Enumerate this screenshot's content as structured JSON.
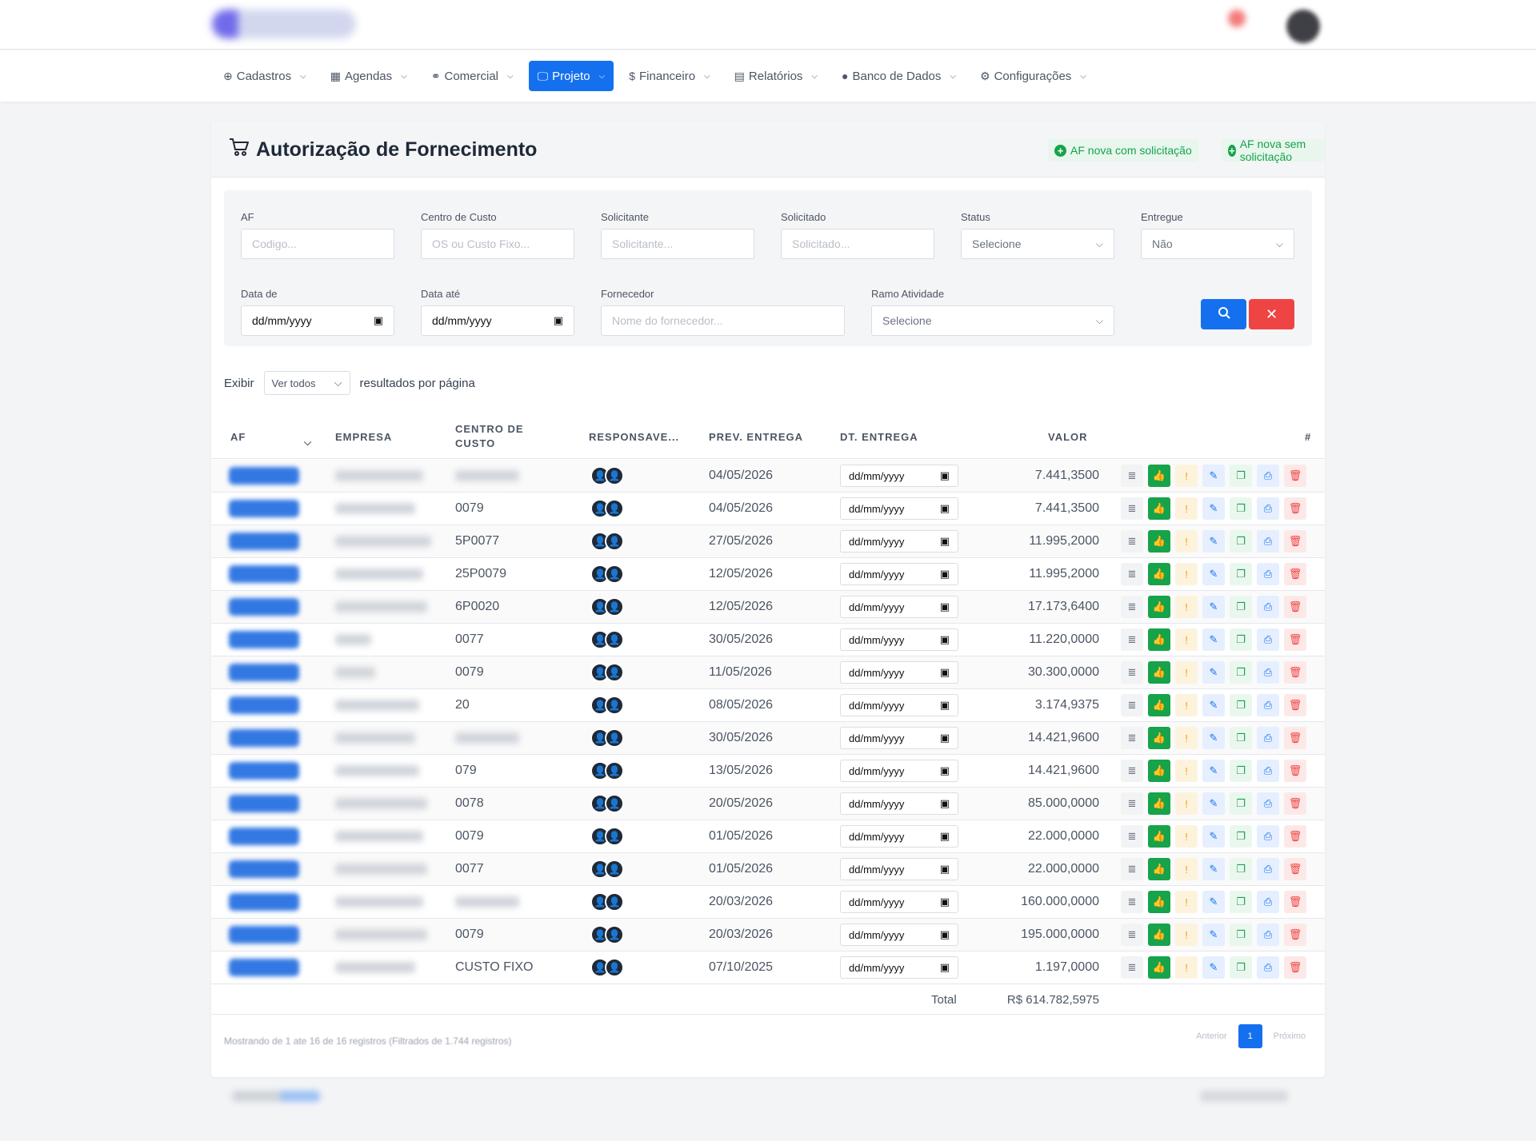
{
  "nav": [
    {
      "label": "Cadastros",
      "icon": "plus-circle-icon",
      "glyph": "⊕"
    },
    {
      "label": "Agendas",
      "icon": "calendar-icon",
      "glyph": "▦"
    },
    {
      "label": "Comercial",
      "icon": "handshake-icon",
      "glyph": "⚭"
    },
    {
      "label": "Projeto",
      "icon": "monitor-icon",
      "glyph": "🖵",
      "active": true
    },
    {
      "label": "Financeiro",
      "icon": "dollar-circle-icon",
      "glyph": "$"
    },
    {
      "label": "Relatórios",
      "icon": "report-icon",
      "glyph": "▤"
    },
    {
      "label": "Banco de Dados",
      "icon": "database-icon",
      "glyph": "●"
    },
    {
      "label": "Configurações",
      "icon": "gear-icon",
      "glyph": "⚙"
    }
  ],
  "page": {
    "title": "Autorização de Fornecimento",
    "badge_with": "AF nova com solicitação",
    "badge_without": "AF nova sem solicitação"
  },
  "filters": {
    "af": {
      "label": "AF",
      "placeholder": "Codigo..."
    },
    "cc": {
      "label": "Centro de Custo",
      "placeholder": "OS ou Custo Fixo..."
    },
    "solicitante": {
      "label": "Solicitante",
      "placeholder": "Solicitante..."
    },
    "solicitado": {
      "label": "Solicitado",
      "placeholder": "Solicitado..."
    },
    "status": {
      "label": "Status",
      "value": "Selecione"
    },
    "entregue": {
      "label": "Entregue",
      "value": "Não"
    },
    "data_de": {
      "label": "Data de",
      "value": "dd/mm/yyyy"
    },
    "data_ate": {
      "label": "Data até",
      "value": "dd/mm/yyyy"
    },
    "fornecedor": {
      "label": "Fornecedor",
      "placeholder": "Nome do fornecedor..."
    },
    "ramo": {
      "label": "Ramo Atividade",
      "value": "Selecione"
    }
  },
  "length": {
    "prefix": "Exibir",
    "value": "Ver todos",
    "suffix": "resultados por página"
  },
  "columns": {
    "af": "AF",
    "empresa": "EMPRESA",
    "cc1": "CENTRO DE",
    "cc2": "CUSTO",
    "resp": "RESPONSAVE...",
    "prev": "PREV. ENTREGA",
    "dt": "DT. ENTREGA",
    "valor": "VALOR",
    "hash": "#"
  },
  "rows": [
    {
      "cc": "",
      "prev": "04/05/2026",
      "dt": "dd/mm/yyyy",
      "valor": "7.441,3500"
    },
    {
      "cc": "0079",
      "prev": "04/05/2026",
      "dt": "dd/mm/yyyy",
      "valor": "7.441,3500"
    },
    {
      "cc": "5P0077",
      "prev": "27/05/2026",
      "dt": "dd/mm/yyyy",
      "valor": "11.995,2000"
    },
    {
      "cc": "25P0079",
      "prev": "12/05/2026",
      "dt": "dd/mm/yyyy",
      "valor": "11.995,2000"
    },
    {
      "cc": "6P0020",
      "prev": "12/05/2026",
      "dt": "dd/mm/yyyy",
      "valor": "17.173,6400"
    },
    {
      "cc": "0077",
      "prev": "30/05/2026",
      "dt": "dd/mm/yyyy",
      "valor": "11.220,0000"
    },
    {
      "cc": "0079",
      "prev": "11/05/2026",
      "dt": "dd/mm/yyyy",
      "valor": "30.300,0000"
    },
    {
      "cc": "20",
      "prev": "08/05/2026",
      "dt": "dd/mm/yyyy",
      "valor": "3.174,9375"
    },
    {
      "cc": "",
      "prev": "30/05/2026",
      "dt": "dd/mm/yyyy",
      "valor": "14.421,9600"
    },
    {
      "cc": "079",
      "prev": "13/05/2026",
      "dt": "dd/mm/yyyy",
      "valor": "14.421,9600"
    },
    {
      "cc": "0078",
      "prev": "20/05/2026",
      "dt": "dd/mm/yyyy",
      "valor": "85.000,0000"
    },
    {
      "cc": "0079",
      "prev": "01/05/2026",
      "dt": "dd/mm/yyyy",
      "valor": "22.000,0000"
    },
    {
      "cc": "0077",
      "prev": "01/05/2026",
      "dt": "dd/mm/yyyy",
      "valor": "22.000,0000"
    },
    {
      "cc": "",
      "prev": "20/03/2026",
      "dt": "dd/mm/yyyy",
      "valor": "160.000,0000"
    },
    {
      "cc": "0079",
      "prev": "20/03/2026",
      "dt": "dd/mm/yyyy",
      "valor": "195.000,0000"
    },
    {
      "cc": "CUSTO FIXO",
      "prev": "07/10/2025",
      "dt": "dd/mm/yyyy",
      "valor": "1.197,0000"
    }
  ],
  "total": {
    "label": "Total",
    "value": "R$ 614.782,5975"
  },
  "footer": {
    "info": "Mostrando de 1 ate 16 de 16 registros (Filtrados de 1.744 registros)",
    "prev": "Anterior",
    "page": "1",
    "next": "Próximo"
  },
  "colors": {
    "primary": "#1570ef",
    "success": "#16a34a",
    "danger": "#ef4444"
  }
}
